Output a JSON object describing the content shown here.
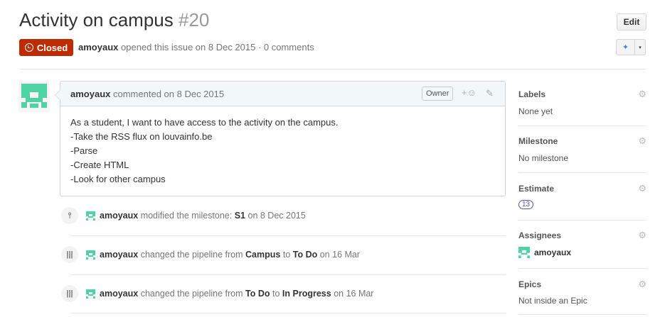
{
  "issue": {
    "title": "Activity on campus",
    "number": "#20",
    "state": "Closed",
    "author": "amoyaux",
    "opened_text": "opened this issue on 8 Dec 2015 · 0 comments"
  },
  "header": {
    "edit_label": "Edit",
    "menu_icon": "zenhub-icon",
    "caret": "▾"
  },
  "comment": {
    "author": "amoyaux",
    "when": "commented on 8 Dec 2015",
    "owner_label": "Owner",
    "reaction_label": "+☺",
    "lines": [
      "As a student, I want to have access to the activity on the campus.",
      "-Take the RSS flux on louvainfo.be",
      "-Parse",
      "-Create HTML",
      "-Look for other campus"
    ]
  },
  "events": [
    {
      "icon": "milestone-icon",
      "glyph": "⫯",
      "actor": "amoyaux",
      "text1": "modified the milestone:",
      "b1": "S1",
      "text2": "on 8 Dec 2015",
      "b2": "",
      "text3": ""
    },
    {
      "icon": "pipeline-icon",
      "glyph": "|||",
      "actor": "amoyaux",
      "text1": "changed the pipeline from",
      "b1": "Campus",
      "text2": "to",
      "b2": "To Do",
      "text3": "on 16 Mar"
    },
    {
      "icon": "pipeline-icon",
      "glyph": "|||",
      "actor": "amoyaux",
      "text1": "changed the pipeline from",
      "b1": "To Do",
      "text2": "to",
      "b2": "In Progress",
      "text3": "on 16 Mar"
    }
  ],
  "sidebar": {
    "labels": {
      "heading": "Labels",
      "value": "None yet"
    },
    "milestone": {
      "heading": "Milestone",
      "value": "No milestone"
    },
    "estimate": {
      "heading": "Estimate",
      "value": "13"
    },
    "assignees": {
      "heading": "Assignees",
      "value": "amoyaux"
    },
    "epics": {
      "heading": "Epics",
      "value": "Not inside an Epic"
    }
  },
  "colors": {
    "closed": "#bd2c00",
    "avatar": "#4fd3a4",
    "estimate": "#4f5ba8"
  }
}
